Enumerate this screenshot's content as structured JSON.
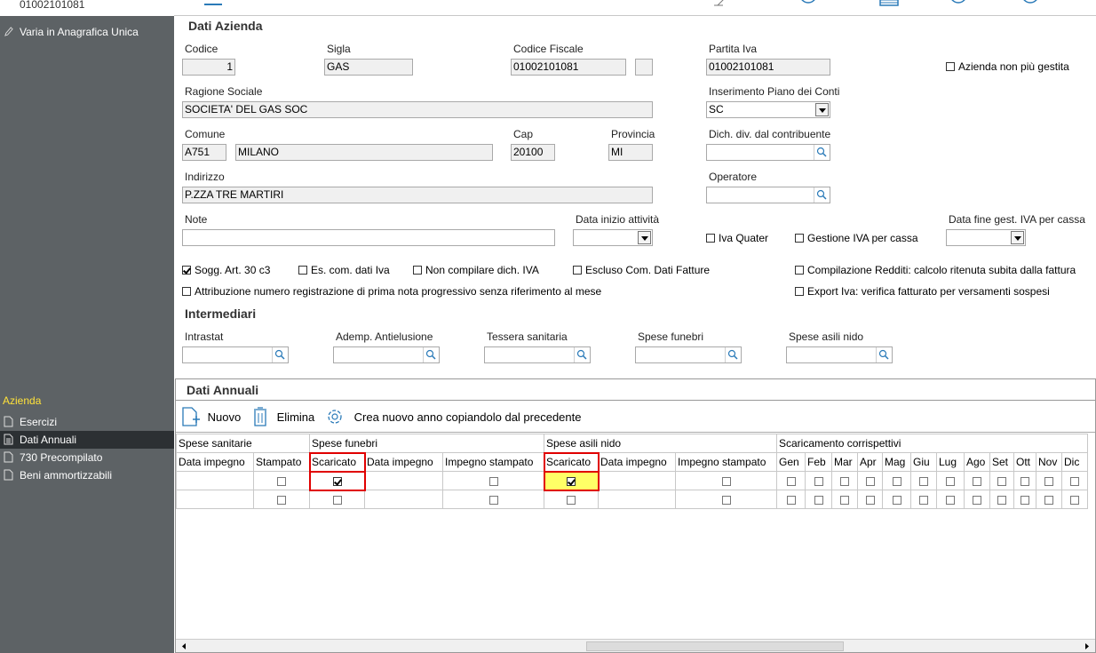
{
  "sidebar": {
    "top_code": "01002101081",
    "varia_label": "Varia in Anagrafica Unica",
    "section_label": "Azienda",
    "items": [
      {
        "label": "Esercizi",
        "active": false
      },
      {
        "label": "Dati Annuali",
        "active": true
      },
      {
        "label": "730 Precompilato",
        "active": false
      },
      {
        "label": "Beni ammortizzabili",
        "active": false
      }
    ]
  },
  "dati_azienda": {
    "title": "Dati Azienda",
    "codice_label": "Codice",
    "codice": "1",
    "sigla_label": "Sigla",
    "sigla": "GAS",
    "cf_label": "Codice  Fiscale",
    "cf": "01002101081",
    "piva_label": "Partita Iva",
    "piva": "01002101081",
    "non_gestita_label": "Azienda non più gestita",
    "ragione_label": "Ragione Sociale",
    "ragione": "SOCIETA' DEL GAS SOC",
    "piano_label": "Inserimento Piano dei Conti",
    "piano": "SC",
    "comune_label": "Comune",
    "comune_code": "A751",
    "comune": "MILANO",
    "cap_label": "Cap",
    "cap": "20100",
    "prov_label": "Provincia",
    "prov": "MI",
    "dich_label": "Dich. div. dal contribuente",
    "indirizzo_label": "Indirizzo",
    "indirizzo": "P.ZZA TRE MARTIRI",
    "operatore_label": "Operatore",
    "note_label": "Note",
    "data_inizio_label": "Data inizio attività",
    "iva_quater_label": "Iva Quater",
    "gestione_iva_label": "Gestione IVA per cassa",
    "data_fine_label": "Data fine gest. IVA per cassa",
    "checks_row1": [
      {
        "label": "Sogg. Art. 30 c3",
        "checked": true
      },
      {
        "label": "Es. com. dati Iva",
        "checked": false
      },
      {
        "label": "Non compilare dich. IVA",
        "checked": false
      },
      {
        "label": "Escluso Com. Dati Fatture",
        "checked": false
      },
      {
        "label": "Compilazione Redditi: calcolo ritenuta subita dalla fattura",
        "checked": false
      }
    ],
    "checks_row2": [
      {
        "label": "Attribuzione numero registrazione di prima nota progressivo senza riferimento al mese",
        "checked": false
      },
      {
        "label": "Export Iva: verifica fatturato per versamenti sospesi",
        "checked": false
      }
    ]
  },
  "intermediari": {
    "title": "Intermediari",
    "fields": [
      "Intrastat",
      "Ademp. Antielusione",
      "Tessera sanitaria",
      "Spese funebri",
      "Spese asili nido"
    ]
  },
  "dati_annuali": {
    "title": "Dati Annuali",
    "toolbar": {
      "nuovo": "Nuovo",
      "elimina": "Elimina",
      "crea": "Crea nuovo anno copiandolo dal precedente"
    },
    "groups": [
      "Spese sanitarie",
      "Spese funebri",
      "Spese asili nido",
      "Scaricamento corrispettivi"
    ],
    "columns": [
      "Data impegno",
      "Stampato",
      "Scaricato",
      "Data impegno",
      "Impegno stampato",
      "Scaricato",
      "Data impegno",
      "Impegno stampato",
      "Gen",
      "Feb",
      "Mar",
      "Apr",
      "Mag",
      "Giu",
      "Lug",
      "Ago",
      "Set",
      "Ott",
      "Nov",
      "Dic"
    ]
  }
}
